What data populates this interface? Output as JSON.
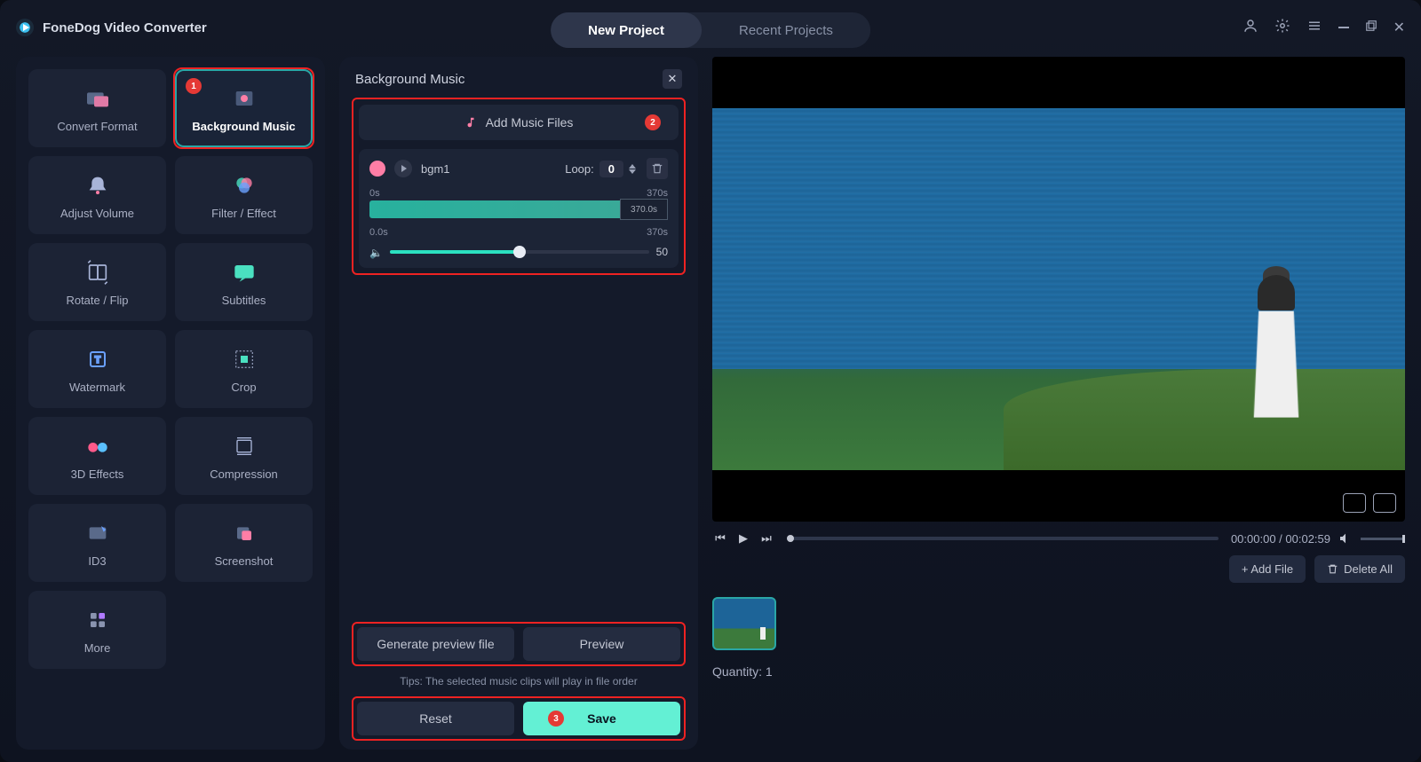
{
  "app": {
    "title": "FoneDog Video Converter"
  },
  "tabs": {
    "new_project": "New Project",
    "recent_projects": "Recent Projects"
  },
  "sidebar": {
    "tiles": {
      "convert_format": "Convert Format",
      "background_music": "Background Music",
      "adjust_volume": "Adjust Volume",
      "filter_effect": "Filter / Effect",
      "rotate_flip": "Rotate / Flip",
      "subtitles": "Subtitles",
      "watermark": "Watermark",
      "crop": "Crop",
      "effects_3d": "3D Effects",
      "compression": "Compression",
      "id3": "ID3",
      "screenshot": "Screenshot",
      "more": "More"
    },
    "badge1": "1"
  },
  "mid": {
    "title": "Background Music",
    "add_files": "Add Music Files",
    "badge2": "2",
    "track": {
      "name": "bgm1",
      "loop_label": "Loop:",
      "loop_value": "0",
      "range_start": "0s",
      "range_end": "370s",
      "handle_label": "370.0s",
      "vol_start": "0.0s",
      "vol_end": "370s",
      "vol_value": "50"
    },
    "generate_preview": "Generate preview file",
    "preview": "Preview",
    "tips": "Tips: The selected music clips will play in file order",
    "reset": "Reset",
    "save": "Save",
    "badge3": "3"
  },
  "player": {
    "time_display": "00:00:00 / 00:02:59"
  },
  "actions": {
    "add_file": "+ Add File",
    "delete_all": "Delete All"
  },
  "quantity": {
    "label": "Quantity: 1"
  }
}
